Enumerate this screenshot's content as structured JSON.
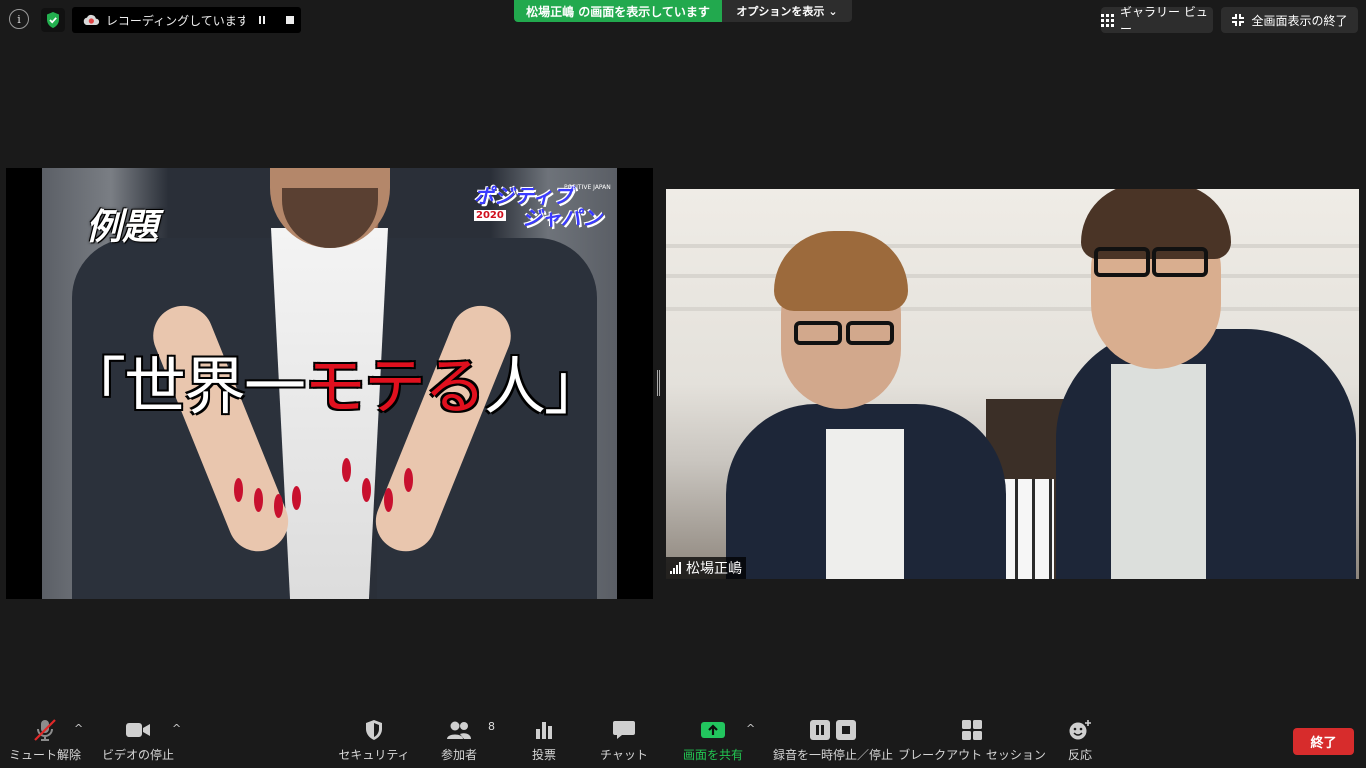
{
  "topbar": {
    "info_icon": "i",
    "recording_label": "レコーディングしています...",
    "share_banner": "松場正嶋 の画面を表示しています",
    "options_label": "オプションを表示",
    "options_caret": "⌄",
    "gallery_view_label": "ギャラリー ビュー",
    "exit_fullscreen_label": "全画面表示の終了"
  },
  "shared_screen": {
    "heading": "例題",
    "title_prefix": "「世界一",
    "title_red": "モテる",
    "title_suffix": "人」",
    "logo_line1": "ポジティブ",
    "logo_line2": "ジャパン",
    "logo_year": "2020",
    "logo_sub": "POSITIVE JAPAN"
  },
  "participant": {
    "name": "松場正嶋"
  },
  "toolbar": {
    "mute_label": "ミュート解除",
    "video_label": "ビデオの停止",
    "security_label": "セキュリティ",
    "participants_label": "参加者",
    "participants_count": "8",
    "polls_label": "投票",
    "chat_label": "チャット",
    "share_label": "画面を共有",
    "record_label": "録音を一時停止／停止",
    "breakout_label": "ブレークアウト セッション",
    "reactions_label": "反応",
    "end_label": "終了",
    "caret": "^"
  },
  "colors": {
    "background": "#1a1a1a",
    "share_green": "#22a94e",
    "end_red": "#d72c2c",
    "mute_red": "#e02828"
  }
}
